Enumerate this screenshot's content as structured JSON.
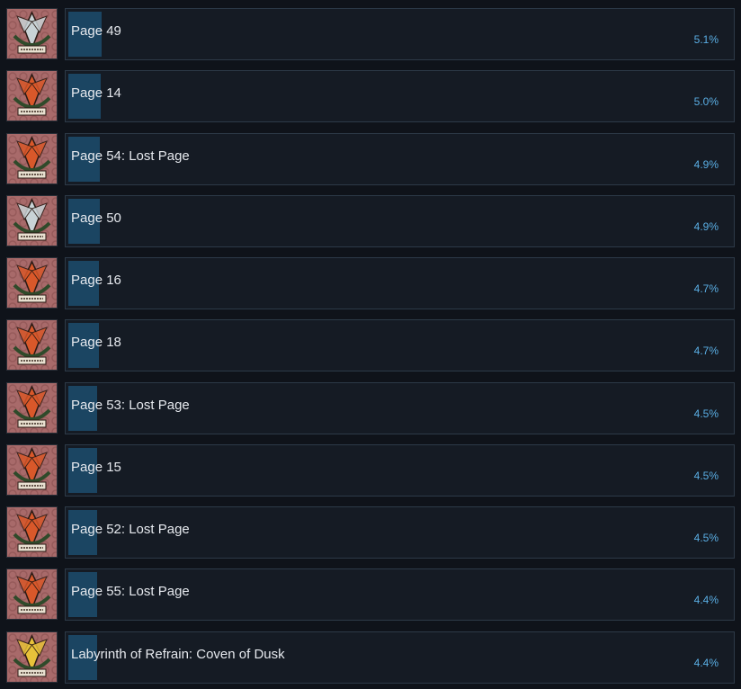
{
  "achievements": [
    {
      "title": "Page 49",
      "percent_label": "5.1%",
      "percent": 5.1,
      "icon": "silver-crest-icon"
    },
    {
      "title": "Page 14",
      "percent_label": "5.0%",
      "percent": 5.0,
      "icon": "red-crest-icon"
    },
    {
      "title": "Page 54: Lost Page",
      "percent_label": "4.9%",
      "percent": 4.9,
      "icon": "red-crest-icon"
    },
    {
      "title": "Page 50",
      "percent_label": "4.9%",
      "percent": 4.9,
      "icon": "silver-crest-icon"
    },
    {
      "title": "Page 16",
      "percent_label": "4.7%",
      "percent": 4.7,
      "icon": "red-crest-icon"
    },
    {
      "title": "Page 18",
      "percent_label": "4.7%",
      "percent": 4.7,
      "icon": "red-crest-icon"
    },
    {
      "title": "Page 53: Lost Page",
      "percent_label": "4.5%",
      "percent": 4.5,
      "icon": "red-crest-icon"
    },
    {
      "title": "Page 15",
      "percent_label": "4.5%",
      "percent": 4.5,
      "icon": "red-crest-icon"
    },
    {
      "title": "Page 52: Lost Page",
      "percent_label": "4.5%",
      "percent": 4.5,
      "icon": "red-crest-icon"
    },
    {
      "title": "Page 55: Lost Page",
      "percent_label": "4.4%",
      "percent": 4.4,
      "icon": "red-crest-icon"
    },
    {
      "title": "Labyrinth of Refrain: Coven of Dusk",
      "percent_label": "4.4%",
      "percent": 4.4,
      "icon": "gold-crest-icon"
    }
  ],
  "icon_colors": {
    "silver-crest-icon": "#c9d3d6",
    "red-crest-icon": "#d9582a",
    "gold-crest-icon": "#e8c23a"
  }
}
